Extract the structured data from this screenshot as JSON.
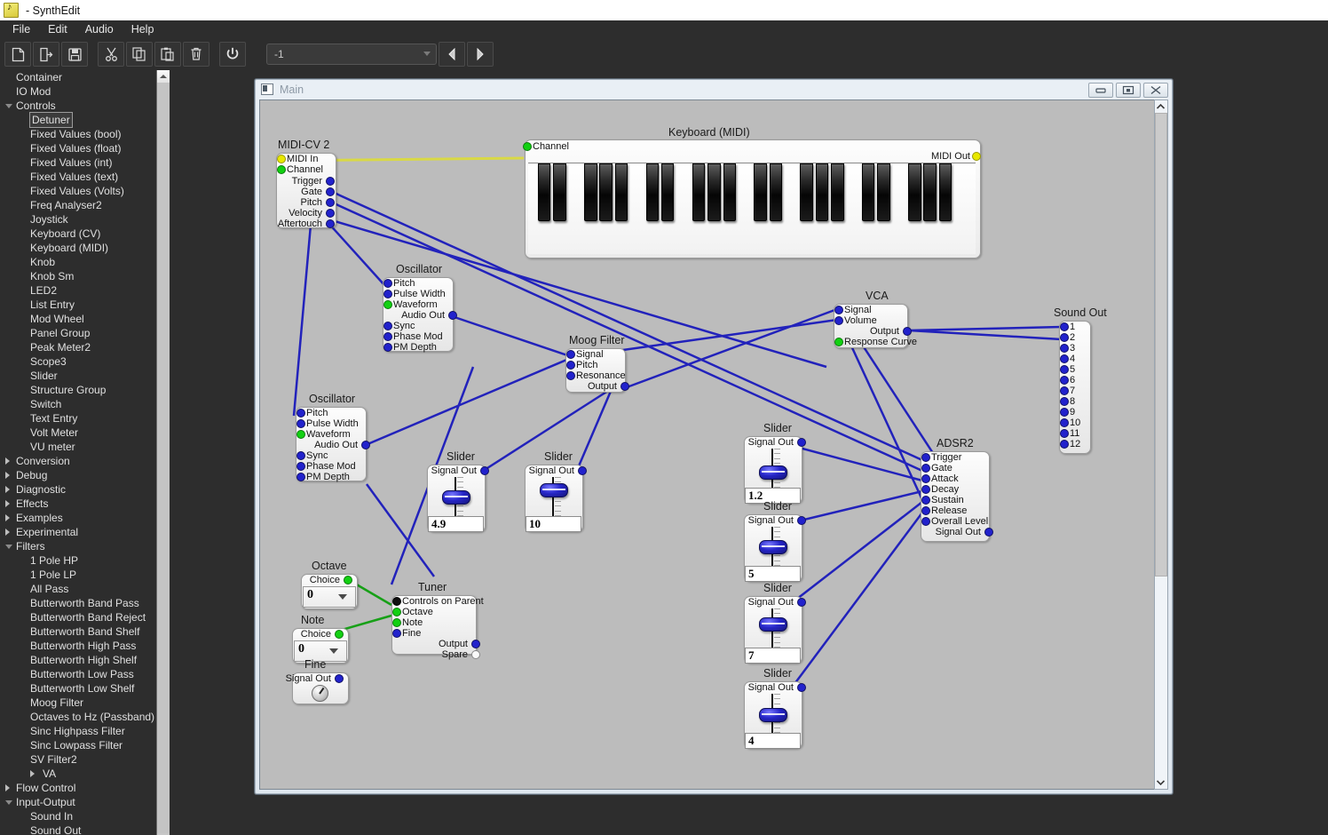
{
  "window": {
    "title": "- SynthEdit",
    "icon": "synthedit-icon"
  },
  "menu": [
    "File",
    "Edit",
    "Audio",
    "Help"
  ],
  "toolbar": {
    "buttons": [
      {
        "name": "new-file-icon",
        "tip": "New"
      },
      {
        "name": "open-file-icon",
        "tip": "Open"
      },
      {
        "name": "save-file-icon",
        "tip": "Save"
      },
      {
        "name": "cut-icon",
        "tip": "Cut"
      },
      {
        "name": "copy-icon",
        "tip": "Copy"
      },
      {
        "name": "paste-icon",
        "tip": "Paste"
      },
      {
        "name": "delete-icon",
        "tip": "Delete"
      },
      {
        "name": "power-icon",
        "tip": "Power"
      }
    ],
    "combo_value": "-1",
    "prev_label": "◀",
    "next_label": "▶"
  },
  "tree": [
    {
      "label": "Container",
      "level": 0,
      "arrow": "none",
      "selected": false
    },
    {
      "label": "IO Mod",
      "level": 0,
      "arrow": "none",
      "selected": false
    },
    {
      "label": "Controls",
      "level": 0,
      "arrow": "open",
      "selected": false
    },
    {
      "label": "Detuner",
      "level": 1,
      "arrow": "none",
      "selected": true
    },
    {
      "label": "Fixed Values (bool)",
      "level": 1,
      "arrow": "none",
      "selected": false
    },
    {
      "label": "Fixed Values (float)",
      "level": 1,
      "arrow": "none",
      "selected": false
    },
    {
      "label": "Fixed Values (int)",
      "level": 1,
      "arrow": "none",
      "selected": false
    },
    {
      "label": "Fixed Values (text)",
      "level": 1,
      "arrow": "none",
      "selected": false
    },
    {
      "label": "Fixed Values (Volts)",
      "level": 1,
      "arrow": "none",
      "selected": false
    },
    {
      "label": "Freq Analyser2",
      "level": 1,
      "arrow": "none",
      "selected": false
    },
    {
      "label": "Joystick",
      "level": 1,
      "arrow": "none",
      "selected": false
    },
    {
      "label": "Keyboard (CV)",
      "level": 1,
      "arrow": "none",
      "selected": false
    },
    {
      "label": "Keyboard (MIDI)",
      "level": 1,
      "arrow": "none",
      "selected": false
    },
    {
      "label": "Knob",
      "level": 1,
      "arrow": "none",
      "selected": false
    },
    {
      "label": "Knob Sm",
      "level": 1,
      "arrow": "none",
      "selected": false
    },
    {
      "label": "LED2",
      "level": 1,
      "arrow": "none",
      "selected": false
    },
    {
      "label": "List Entry",
      "level": 1,
      "arrow": "none",
      "selected": false
    },
    {
      "label": "Mod Wheel",
      "level": 1,
      "arrow": "none",
      "selected": false
    },
    {
      "label": "Panel Group",
      "level": 1,
      "arrow": "none",
      "selected": false
    },
    {
      "label": "Peak Meter2",
      "level": 1,
      "arrow": "none",
      "selected": false
    },
    {
      "label": "Scope3",
      "level": 1,
      "arrow": "none",
      "selected": false
    },
    {
      "label": "Slider",
      "level": 1,
      "arrow": "none",
      "selected": false
    },
    {
      "label": "Structure Group",
      "level": 1,
      "arrow": "none",
      "selected": false
    },
    {
      "label": "Switch",
      "level": 1,
      "arrow": "none",
      "selected": false
    },
    {
      "label": "Text Entry",
      "level": 1,
      "arrow": "none",
      "selected": false
    },
    {
      "label": "Volt Meter",
      "level": 1,
      "arrow": "none",
      "selected": false
    },
    {
      "label": "VU meter",
      "level": 1,
      "arrow": "none",
      "selected": false
    },
    {
      "label": "Conversion",
      "level": 0,
      "arrow": "closed",
      "selected": false
    },
    {
      "label": "Debug",
      "level": 0,
      "arrow": "closed",
      "selected": false
    },
    {
      "label": "Diagnostic",
      "level": 0,
      "arrow": "closed",
      "selected": false
    },
    {
      "label": "Effects",
      "level": 0,
      "arrow": "closed",
      "selected": false
    },
    {
      "label": "Examples",
      "level": 0,
      "arrow": "closed",
      "selected": false
    },
    {
      "label": "Experimental",
      "level": 0,
      "arrow": "closed",
      "selected": false
    },
    {
      "label": "Filters",
      "level": 0,
      "arrow": "open",
      "selected": false
    },
    {
      "label": "1 Pole HP",
      "level": 1,
      "arrow": "none",
      "selected": false
    },
    {
      "label": "1 Pole LP",
      "level": 1,
      "arrow": "none",
      "selected": false
    },
    {
      "label": "All Pass",
      "level": 1,
      "arrow": "none",
      "selected": false
    },
    {
      "label": "Butterworth Band Pass",
      "level": 1,
      "arrow": "none",
      "selected": false
    },
    {
      "label": "Butterworth Band Reject",
      "level": 1,
      "arrow": "none",
      "selected": false
    },
    {
      "label": "Butterworth Band Shelf",
      "level": 1,
      "arrow": "none",
      "selected": false
    },
    {
      "label": "Butterworth High Pass",
      "level": 1,
      "arrow": "none",
      "selected": false
    },
    {
      "label": "Butterworth High Shelf",
      "level": 1,
      "arrow": "none",
      "selected": false
    },
    {
      "label": "Butterworth Low Pass",
      "level": 1,
      "arrow": "none",
      "selected": false
    },
    {
      "label": "Butterworth Low Shelf",
      "level": 1,
      "arrow": "none",
      "selected": false
    },
    {
      "label": "Moog Filter",
      "level": 1,
      "arrow": "none",
      "selected": false
    },
    {
      "label": "Octaves to Hz (Passband)",
      "level": 1,
      "arrow": "none",
      "selected": false
    },
    {
      "label": "Sinc Highpass Filter",
      "level": 1,
      "arrow": "none",
      "selected": false
    },
    {
      "label": "Sinc Lowpass Filter",
      "level": 1,
      "arrow": "none",
      "selected": false
    },
    {
      "label": "SV Filter2",
      "level": 1,
      "arrow": "none",
      "selected": false
    },
    {
      "label": "VA",
      "level": 2,
      "arrow": "closed",
      "selected": false
    },
    {
      "label": "Flow Control",
      "level": 0,
      "arrow": "closed",
      "selected": false
    },
    {
      "label": "Input-Output",
      "level": 0,
      "arrow": "open",
      "selected": false
    },
    {
      "label": "Sound In",
      "level": 1,
      "arrow": "none",
      "selected": false
    },
    {
      "label": "Sound Out",
      "level": 1,
      "arrow": "none",
      "selected": false
    }
  ],
  "child_window": {
    "title": "Main",
    "minimize_label": "minimize-icon",
    "restore_label": "restore-icon",
    "close_label": "close-icon"
  },
  "modules": {
    "midicv2": {
      "title": "MIDI-CV 2",
      "inputs": [
        "MIDI In",
        "Channel"
      ],
      "outputs": [
        "Trigger",
        "Gate",
        "Pitch",
        "Velocity",
        "Aftertouch"
      ]
    },
    "keyboard": {
      "title": "Keyboard (MIDI)",
      "input": "Channel",
      "output": "MIDI Out"
    },
    "oscillator1": {
      "title": "Oscillator",
      "inputs": [
        "Pitch",
        "Pulse Width",
        "Waveform"
      ],
      "output": "Audio Out",
      "inputs2": [
        "Sync",
        "Phase Mod",
        "PM Depth"
      ]
    },
    "oscillator2": {
      "title": "Oscillator",
      "inputs": [
        "Pitch",
        "Pulse Width",
        "Waveform"
      ],
      "output": "Audio Out",
      "inputs2": [
        "Sync",
        "Phase Mod",
        "PM Depth"
      ]
    },
    "moogfilter": {
      "title": "Moog Filter",
      "inputs": [
        "Signal",
        "Pitch",
        "Resonance"
      ],
      "output": "Output"
    },
    "vca": {
      "title": "VCA",
      "inputs": [
        "Signal",
        "Volume"
      ],
      "output": "Output",
      "input_extra": "Response Curve"
    },
    "adsr2": {
      "title": "ADSR2",
      "inputs": [
        "Trigger",
        "Gate",
        "Attack",
        "Decay",
        "Sustain",
        "Release",
        "Overall Level"
      ],
      "output": "Signal Out"
    },
    "soundout": {
      "title": "Sound Out",
      "channels": [
        "1",
        "2",
        "3",
        "4",
        "5",
        "6",
        "7",
        "8",
        "9",
        "10",
        "11",
        "12"
      ]
    },
    "tuner": {
      "title": "Tuner",
      "inputs": [
        "Controls on Parent",
        "Octave",
        "Note",
        "Fine"
      ],
      "outputs": [
        "Output",
        "Spare"
      ]
    },
    "octave": {
      "title": "Octave",
      "port": "Choice",
      "value": "0"
    },
    "note": {
      "title": "Note",
      "port": "Choice",
      "value": "0"
    },
    "fine": {
      "title": "Fine",
      "port": "Signal Out"
    },
    "sliders": [
      {
        "title": "Slider",
        "port": "Signal Out",
        "value": "4.9",
        "pos": 0.5
      },
      {
        "title": "Slider",
        "port": "Signal Out",
        "value": "10",
        "pos": 0.22
      },
      {
        "title": "Slider",
        "port": "Signal Out",
        "value": "1.2",
        "pos": 0.62
      },
      {
        "title": "Slider",
        "port": "Signal Out",
        "value": "5",
        "pos": 0.5
      },
      {
        "title": "Slider",
        "port": "Signal Out",
        "value": "7",
        "pos": 0.34
      },
      {
        "title": "Slider",
        "port": "Signal Out",
        "value": "4",
        "pos": 0.52
      }
    ]
  },
  "colors": {
    "wire_blue": "#2222bb",
    "wire_green": "#17a017",
    "wire_yellow": "#d9d945",
    "canvas_bg": "#bcbcbc",
    "panel_dark": "#2d2d2d"
  }
}
